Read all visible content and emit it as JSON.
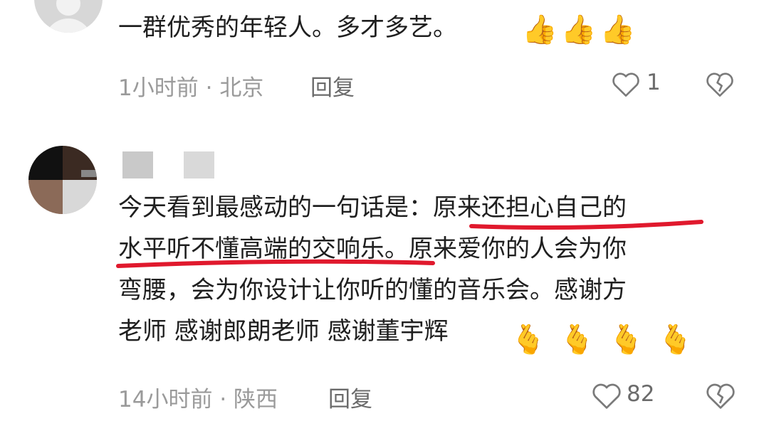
{
  "comment1": {
    "text": "一群优秀的年轻人。多才多艺。",
    "emojis": [
      "👍",
      "👍",
      "👍"
    ],
    "time": "1小时前",
    "location": "北京",
    "reply_label": "回复",
    "like_count": "1"
  },
  "comment2": {
    "lines": [
      "今天看到最感动的一句话是：原来还担心自己的",
      "水平听不懂高端的交响乐。原来爱你的人会为你",
      "弯腰，会为你设计让你听的懂的音乐会。感谢方",
      "老师 感谢郎朗老师 感谢董宇辉"
    ],
    "emojis": [
      "🫰",
      "🫰",
      "🫰",
      "🫰"
    ],
    "time": "14小时前",
    "location": "陕西",
    "reply_label": "回复",
    "like_count": "82"
  },
  "colors": {
    "underline": "#e0192d",
    "meta_text": "#9a9a9a",
    "body_text": "#1f1f1f"
  },
  "icons": [
    "heart-outline-icon",
    "broken-heart-icon",
    "thumbs-up-emoji",
    "finger-heart-emoji"
  ]
}
